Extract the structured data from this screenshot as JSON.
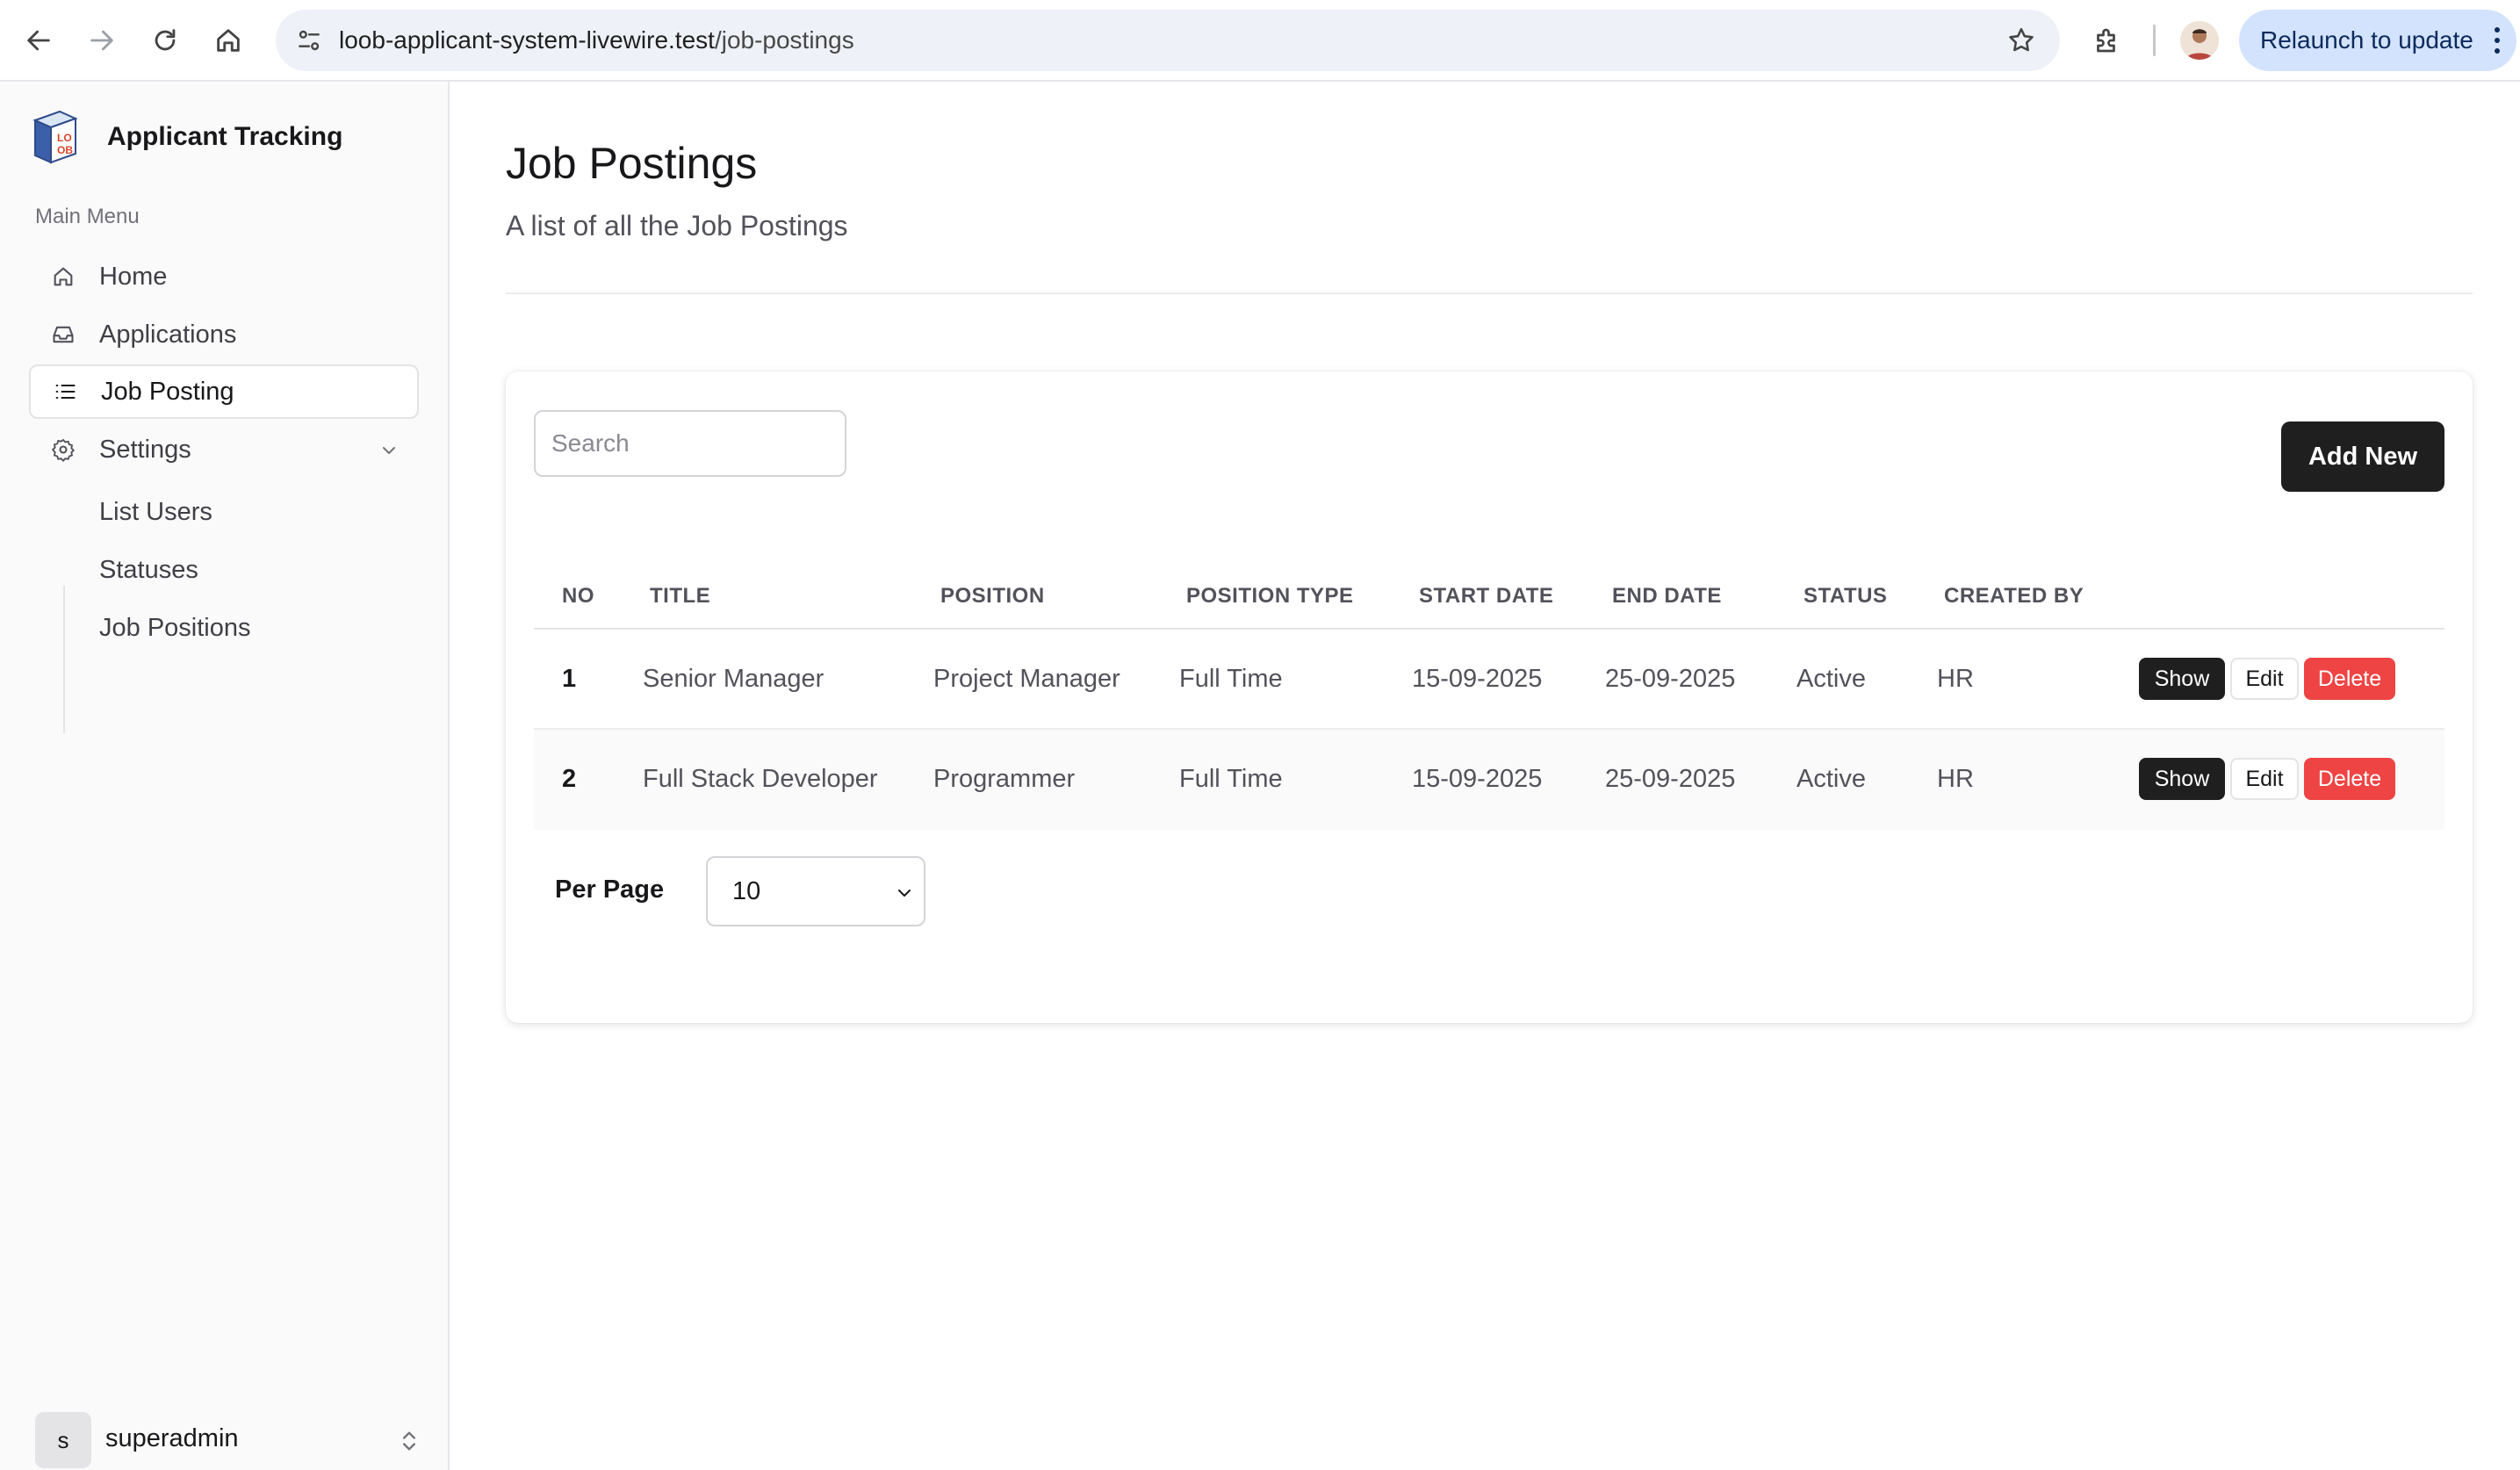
{
  "browser": {
    "url_host": "loob-applicant-system-livewire.test",
    "url_path": "/job-postings",
    "relaunch_label": "Relaunch to update"
  },
  "sidebar": {
    "brand": "Applicant Tracking",
    "logo_letters": "LOOB",
    "menu_heading": "Main Menu",
    "items": [
      {
        "label": "Home",
        "icon": "home-icon"
      },
      {
        "label": "Applications",
        "icon": "inbox-icon"
      },
      {
        "label": "Job Posting",
        "icon": "list-icon",
        "active": true
      },
      {
        "label": "Settings",
        "icon": "gear-icon",
        "expanded": true
      }
    ],
    "settings_children": [
      "List Users",
      "Statuses",
      "Job Positions"
    ],
    "user": {
      "initial": "s",
      "name": "superadmin"
    }
  },
  "page": {
    "title": "Job Postings",
    "subtitle": "A list of all the Job Postings"
  },
  "toolbar": {
    "search_placeholder": "Search",
    "add_new_label": "Add New"
  },
  "table": {
    "columns": [
      "NO",
      "TITLE",
      "POSITION",
      "POSITION TYPE",
      "START DATE",
      "END DATE",
      "STATUS",
      "CREATED BY"
    ],
    "rows": [
      {
        "no": "1",
        "title": "Senior Manager",
        "position": "Project Manager",
        "position_type": "Full Time",
        "start_date": "15-09-2025",
        "end_date": "25-09-2025",
        "status": "Active",
        "created_by": "HR"
      },
      {
        "no": "2",
        "title": "Full Stack Developer",
        "position": "Programmer",
        "position_type": "Full Time",
        "start_date": "15-09-2025",
        "end_date": "25-09-2025",
        "status": "Active",
        "created_by": "HR"
      }
    ],
    "actions": {
      "show": "Show",
      "edit": "Edit",
      "delete": "Delete"
    }
  },
  "pagination": {
    "per_page_label": "Per Page",
    "per_page_value": "10"
  },
  "colors": {
    "primary_dark": "#1f1f1f",
    "danger": "#ef4444",
    "relaunch_bg": "#d3e3fd"
  }
}
